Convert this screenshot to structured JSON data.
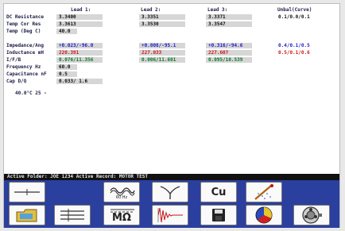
{
  "headers": {
    "lead1": "Lead 1:",
    "lead2": "Lead 2:",
    "lead3": "Lead 3:",
    "unbal": "Unbal(Curve)"
  },
  "rows": [
    {
      "label": "DC Resistance",
      "c1": "3.3400",
      "c2": "3.3351",
      "c3": "3.3371",
      "c4": "0.1/0.0/0.1"
    },
    {
      "label": "Temp Cor Res",
      "c1": "3.3613",
      "c2": "3.3530",
      "c3": "3.3547"
    },
    {
      "label": "Temp (Deg C)",
      "short": "40.0"
    },
    {
      "label": "Impedance/Ang",
      "c1": "+0.023/-96.0",
      "c2": "+0.008/-95.1",
      "c3": "+0.316/-94.6",
      "c4": "0.4/0.1/0.5"
    },
    {
      "label": "Inductance mH",
      "c1": "220.391",
      "c2": "227.033",
      "c3": "227.607",
      "c4": "0.5/0.1/0.6"
    },
    {
      "label": "I/F/B",
      "c1": "0.076/11.356",
      "c2": "0.006/11.601",
      "c3": "0.095/10.539"
    },
    {
      "label": "Frequency Hz",
      "short": "60.0"
    },
    {
      "label": "Capacitance nF",
      "short": "0.5"
    },
    {
      "label": "Cap D/Q",
      "c1": "0.033/  1.6"
    }
  ],
  "temp_line": "40.0°C  25 -",
  "status_bar": "Active Folder: JOE 1234   Active Record: MOTOR TEST",
  "buttons_row1": [
    {
      "name": "lead-config-button",
      "icon": "single-line-icon"
    },
    {
      "name": "frequency-button",
      "icon": "sine-wave-icon",
      "text": "60 Hz"
    },
    {
      "name": "phase-button",
      "icon": "y-wave-icon"
    },
    {
      "name": "copper-button",
      "icon": "cu-text-icon",
      "text": "Cu"
    },
    {
      "name": "temperature-button",
      "icon": "thermometer-icon"
    }
  ],
  "buttons_row2": [
    {
      "name": "folder-button",
      "icon": "folder-icon"
    },
    {
      "name": "three-phase-button",
      "icon": "three-lines-icon"
    },
    {
      "name": "resistance-button",
      "icon": "ohm-icon",
      "text": "MΩ"
    },
    {
      "name": "waveform-button",
      "icon": "damped-wave-icon"
    },
    {
      "name": "save-button",
      "icon": "floppy-disk-icon"
    },
    {
      "name": "pie-chart-button",
      "icon": "pie-chart-icon"
    },
    {
      "name": "motor-button",
      "icon": "motor-icon"
    }
  ],
  "colors": {
    "panel_blue": "#2b3f9e",
    "status_black": "#111111",
    "cell_gray": "#d6d6d6",
    "red_text": "#d01818",
    "blue_text": "#2020c8",
    "green_text": "#0b7a2a"
  }
}
